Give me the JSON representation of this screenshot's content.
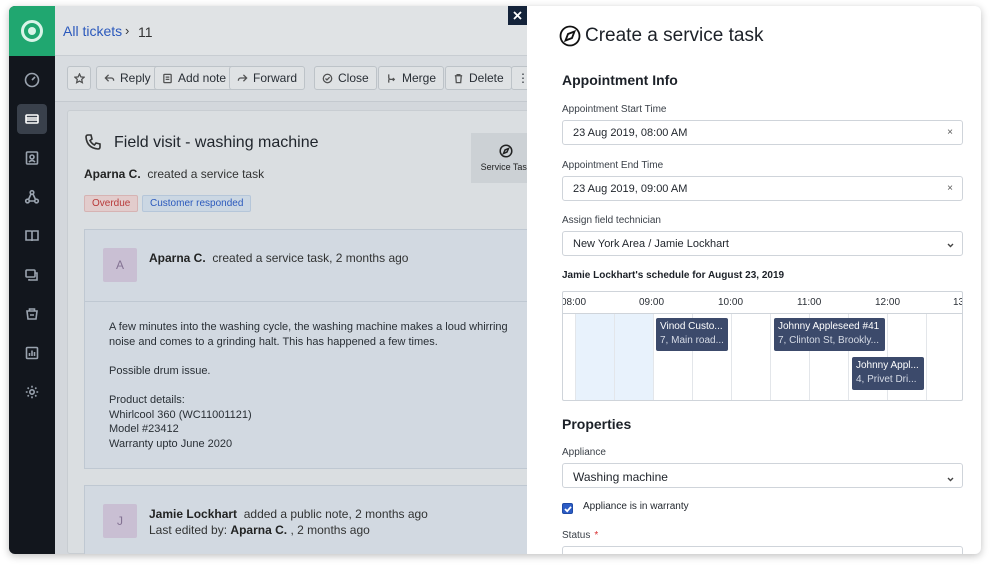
{
  "colors": {
    "sidebar_bg": "#12161d",
    "logo_bg": "#20a770",
    "link": "#2c5cc5",
    "overdue": "#c23b3b",
    "event_bg": "#3c4a6b",
    "required": "#d72d30"
  },
  "sidebar": {
    "items": [
      {
        "name": "dashboard-icon"
      },
      {
        "name": "tickets-icon",
        "active": true
      },
      {
        "name": "contacts-icon"
      },
      {
        "name": "groups-icon"
      },
      {
        "name": "solutions-icon"
      },
      {
        "name": "forums-icon"
      },
      {
        "name": "inventory-icon"
      },
      {
        "name": "reports-icon"
      },
      {
        "name": "settings-icon"
      }
    ]
  },
  "breadcrumb": {
    "all_tickets": "All tickets",
    "separator": "›",
    "ticket_number": "11"
  },
  "toolbar": {
    "reply": "Reply",
    "add_note": "Add note",
    "forward": "Forward",
    "close": "Close",
    "merge": "Merge",
    "delete": "Delete",
    "more": "⋮"
  },
  "ticket": {
    "title": "Field visit - washing machine",
    "creator": "Aparna C.",
    "created_text": "created a service task",
    "badges": {
      "overdue": "Overdue",
      "responded": "Customer responded"
    },
    "service_task_label": "Service Task"
  },
  "conversations": [
    {
      "avatar": "A",
      "author": "Aparna C.",
      "action": "created a service task, 2 months ago",
      "body": "A few minutes into the washing cycle, the washing machine makes a loud whirring\nnoise and comes to a grinding halt. This has happened a few times.\n\nPossible drum issue.\n\nProduct details:\nWhirlcool 360 (WC11001121)\nModel #23412\nWarranty upto June 2020"
    },
    {
      "avatar": "J",
      "author": "Jamie Lockhart",
      "action": "added a public note, 2 months ago",
      "edited_prefix": "Last edited by:",
      "edited_by": "Aparna C.",
      "edited_suffix": ", 2 months ago"
    }
  ],
  "panel": {
    "title": "Create a service task",
    "appointment_section": "Appointment Info",
    "start_label": "Appointment Start Time",
    "start_value": "23 Aug 2019, 08:00 AM",
    "end_label": "Appointment End Time",
    "end_value": "23 Aug 2019, 09:00 AM",
    "clear_icon": "×",
    "technician_label": "Assign field technician",
    "technician_value": "New York Area / Jamie Lockhart",
    "schedule_title": "Jamie Lockhart's schedule for August 23, 2019",
    "times": [
      "08:00",
      "09:00",
      "10:00",
      "11:00",
      "12:00",
      "13"
    ],
    "events": [
      {
        "title": "Vinod Custo...",
        "address": "7, Main road..."
      },
      {
        "title": "Johnny Appleseed #41",
        "address": "7, Clinton St, Brookly..."
      },
      {
        "title": "Johnny Appl...",
        "address": "4, Privet Dri..."
      }
    ],
    "properties_section": "Properties",
    "appliance_label": "Appliance",
    "appliance_value": "Washing machine",
    "warranty_label": "Appliance is in warranty",
    "warranty_checked": true,
    "status_label": "Status",
    "status_required": "*"
  }
}
